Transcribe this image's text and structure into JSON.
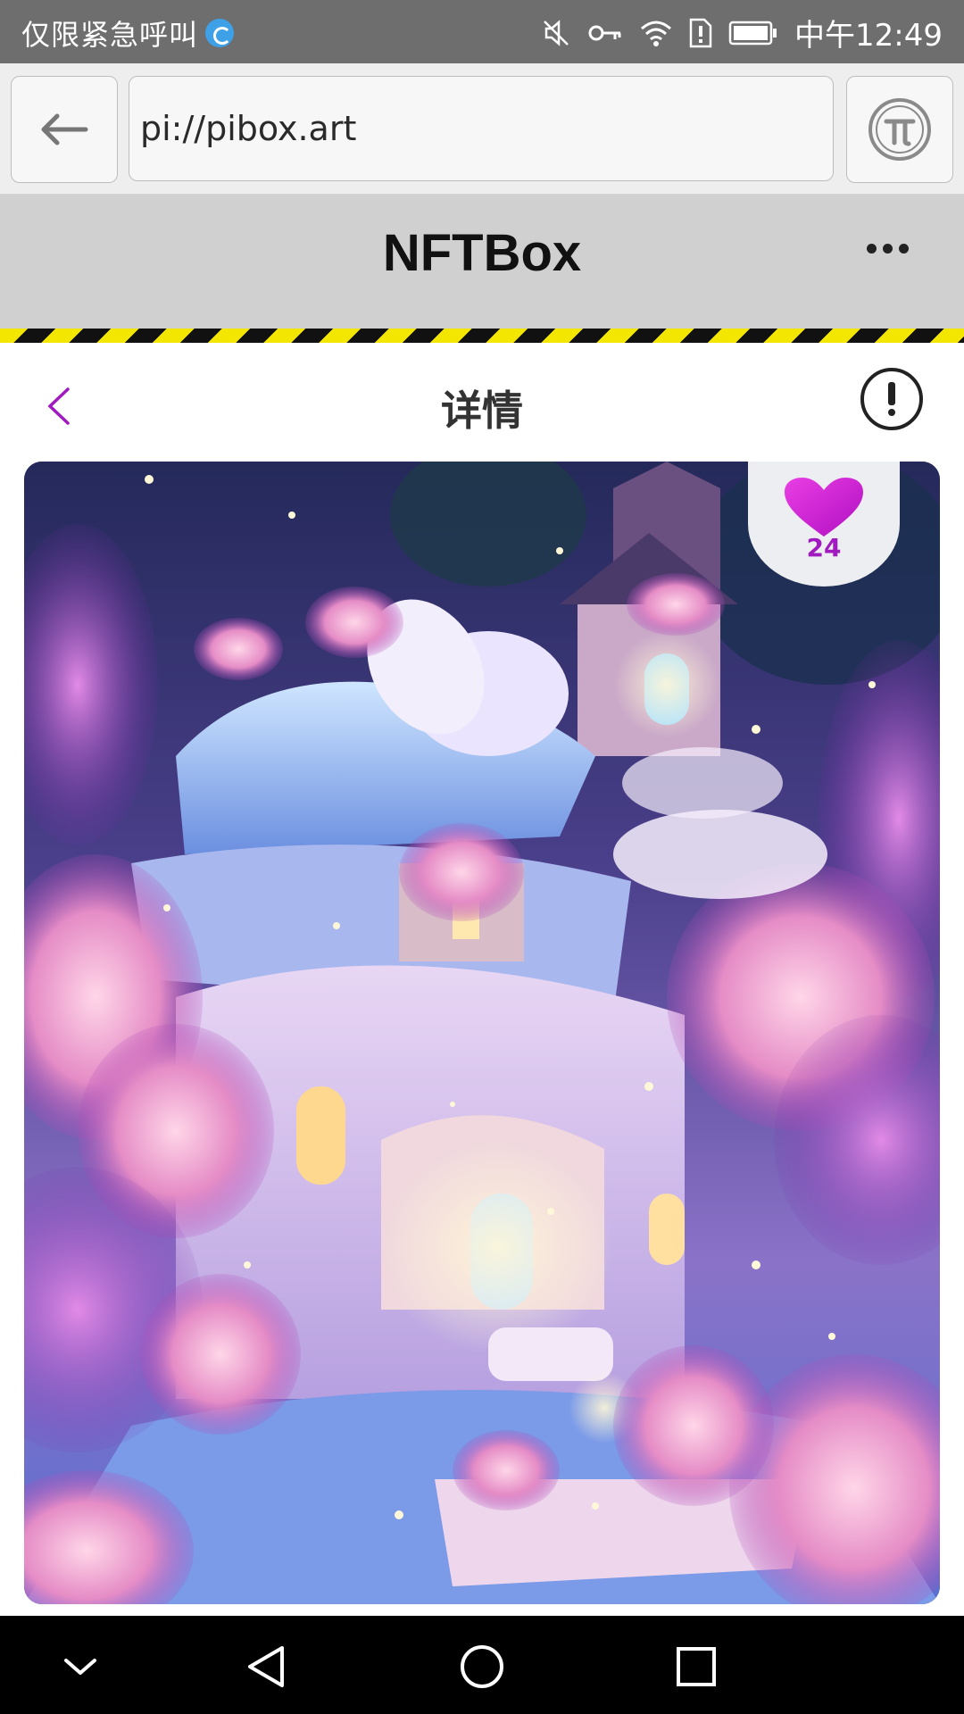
{
  "status_bar": {
    "carrier_text": "仅限紧急呼叫",
    "time": "中午12:49",
    "icons": [
      "mute-icon",
      "vpn-key-icon",
      "wifi-icon",
      "sim-alert-icon",
      "battery-icon"
    ]
  },
  "browser": {
    "url": "pi://pibox.art",
    "back_icon": "arrow-left-icon",
    "pi_icon": "pi-network-icon"
  },
  "app_header": {
    "title": "NFTBox",
    "more_icon": "more-horizontal-icon"
  },
  "detail": {
    "title": "详情",
    "back_icon": "chevron-left-icon",
    "info_icon": "info-circle-icon",
    "accent_color": "#a01ac0"
  },
  "artwork": {
    "likes": "24",
    "like_icon": "heart-icon",
    "like_color": "#c21bd0"
  },
  "navigation_bar": {
    "buttons": [
      "collapse-icon",
      "back-triangle-icon",
      "home-circle-icon",
      "recents-square-icon"
    ]
  }
}
